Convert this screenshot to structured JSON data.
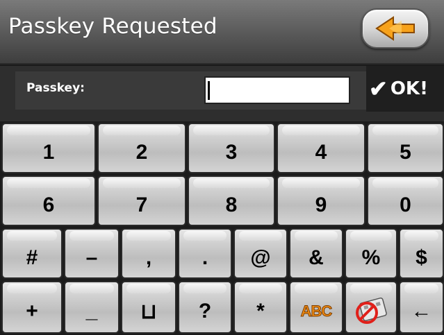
{
  "header": {
    "title": "Passkey Requested",
    "back_icon": "back-arrow-icon"
  },
  "passkey": {
    "label": "Passkey:",
    "value": "",
    "ok_check": "✔",
    "ok_label": "OK!"
  },
  "keypad": {
    "row1": [
      "1",
      "2",
      "3",
      "4",
      "5"
    ],
    "row2": [
      "6",
      "7",
      "8",
      "9",
      "0"
    ],
    "row3": [
      "#",
      "–",
      ",",
      ".",
      "@",
      "&",
      "%",
      "$"
    ],
    "row4": {
      "plus": "+",
      "underscore": "_",
      "space": "⊔",
      "question": "?",
      "asterisk": "*",
      "abc": "ABC",
      "backspace": "←"
    }
  },
  "colors": {
    "accent_orange": "#f28c12",
    "title_bar": "#5e5e5e",
    "key_face": "#cfcfcf"
  }
}
